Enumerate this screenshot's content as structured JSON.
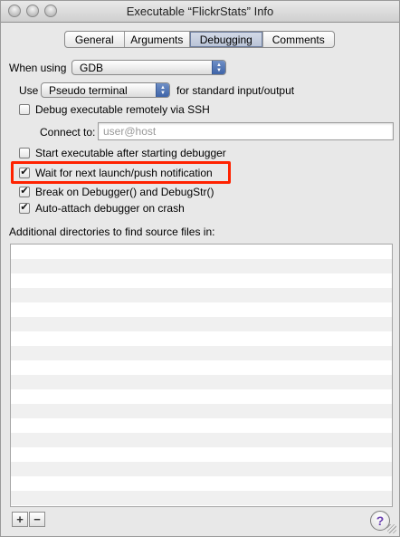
{
  "window": {
    "title": "Executable “FlickrStats” Info"
  },
  "tabs": [
    {
      "label": "General"
    },
    {
      "label": "Arguments"
    },
    {
      "label": "Debugging",
      "selected": true
    },
    {
      "label": "Comments"
    }
  ],
  "debugger": {
    "label": "When using",
    "selected": "GDB"
  },
  "io": {
    "label": "Use",
    "selected": "Pseudo terminal",
    "suffix": "for standard input/output"
  },
  "remote_ssh": {
    "label": "Debug executable remotely via SSH",
    "checked": false
  },
  "connect": {
    "label": "Connect to:",
    "placeholder": "user@host",
    "value": ""
  },
  "options": [
    {
      "label": "Start executable after starting debugger",
      "checked": false
    },
    {
      "label": "Wait for next launch/push notification",
      "checked": true
    },
    {
      "label": "Break on Debugger() and DebugStr()",
      "checked": true
    },
    {
      "label": "Auto-attach debugger on crash",
      "checked": true
    }
  ],
  "source_dirs": {
    "label": "Additional directories to find source files in:",
    "items": []
  },
  "buttons": {
    "add": "+",
    "remove": "−",
    "help": "?"
  },
  "colors": {
    "highlight": "#ff2200",
    "selected_tab": "#b9c3d6"
  }
}
